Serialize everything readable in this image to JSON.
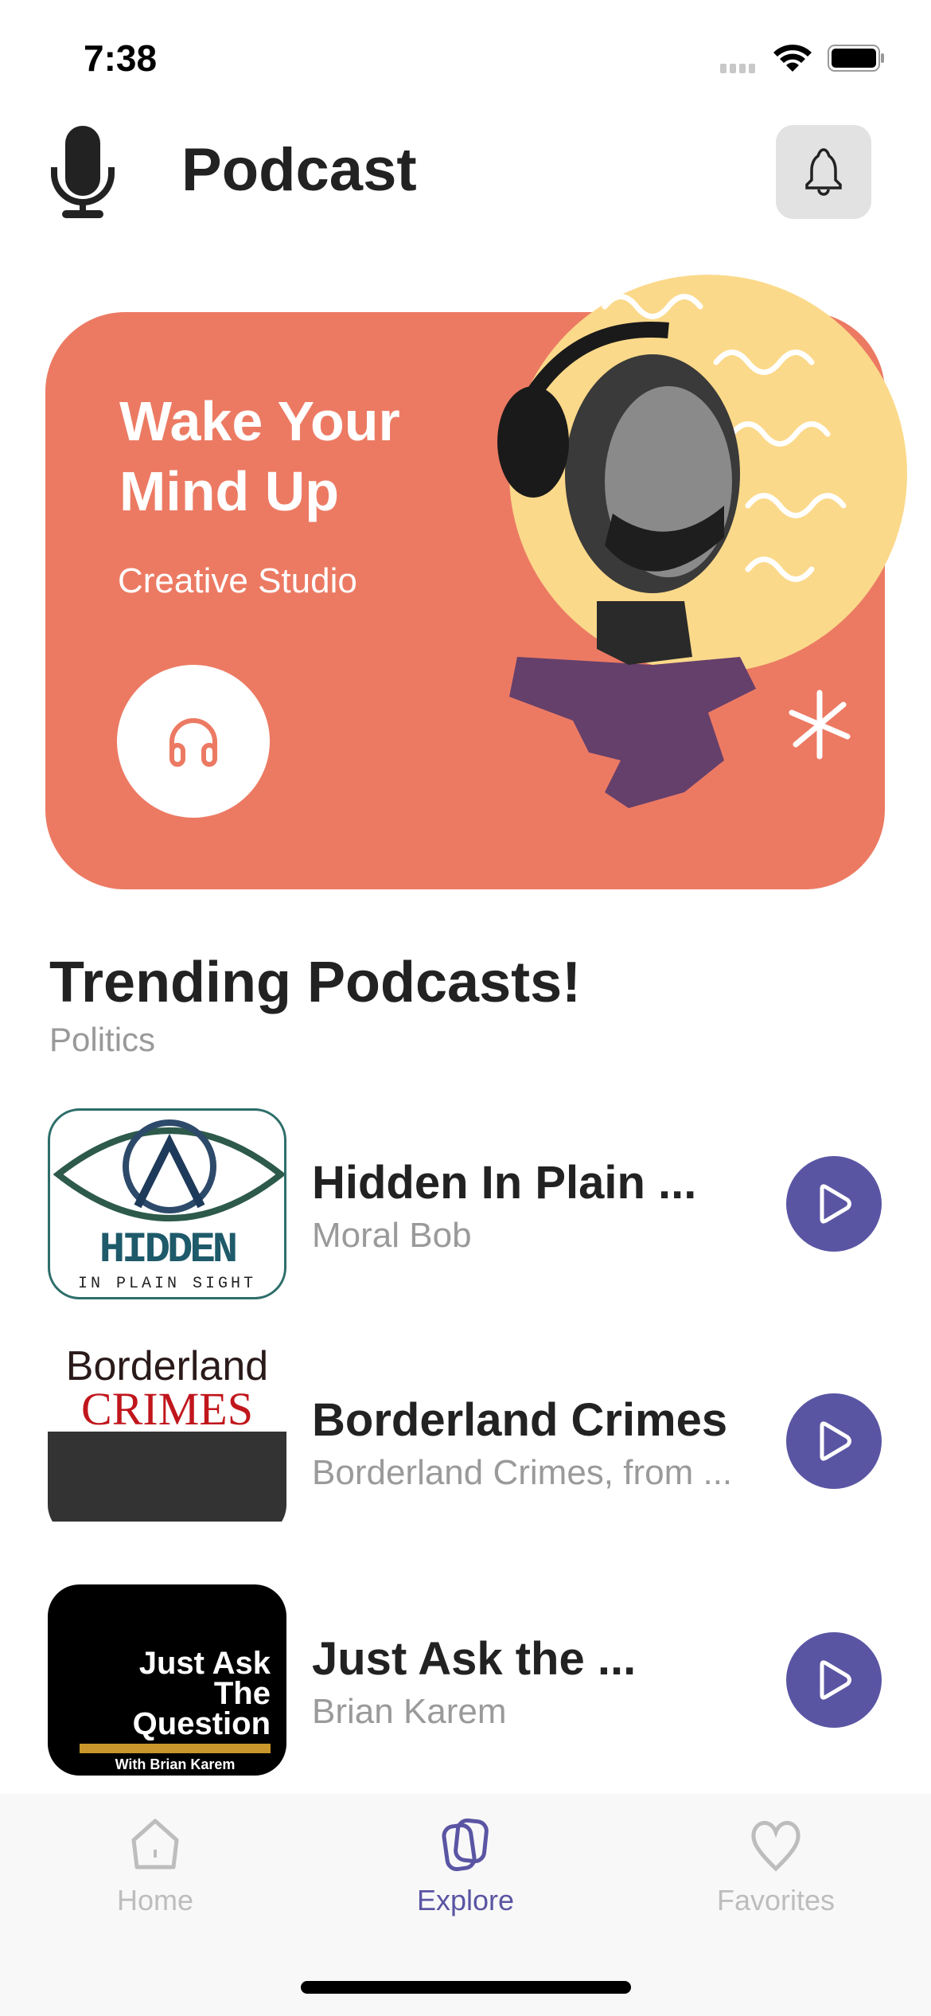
{
  "status_bar": {
    "time": "7:38"
  },
  "header": {
    "title": "Podcast"
  },
  "banner": {
    "title": "Wake Your Mind Up",
    "subtitle": "Creative Studio",
    "bg_color": "#ec7a63",
    "accent_color": "#fbd98a"
  },
  "section": {
    "title": "Trending Podcasts!",
    "subtitle": "Politics"
  },
  "podcasts": [
    {
      "title": "Hidden In Plain ...",
      "author": "Moral Bob",
      "art_text": "HIDDEN",
      "art_sub": "IN PLAIN SIGHT"
    },
    {
      "title": "Borderland Crimes",
      "author": "Borderland Crimes, from ...",
      "art_text": "Borderland",
      "art_sub": "CRIMES"
    },
    {
      "title": "Just Ask the ...",
      "author": "Brian Karem",
      "art_text": "Just Ask The Question",
      "art_sub": "With Brian Karem"
    }
  ],
  "tabs": [
    {
      "label": "Home",
      "icon": "home-icon"
    },
    {
      "label": "Explore",
      "icon": "explore-icon",
      "active": true
    },
    {
      "label": "Favorites",
      "icon": "heart-icon"
    }
  ],
  "colors": {
    "accent": "#5a55a3"
  }
}
